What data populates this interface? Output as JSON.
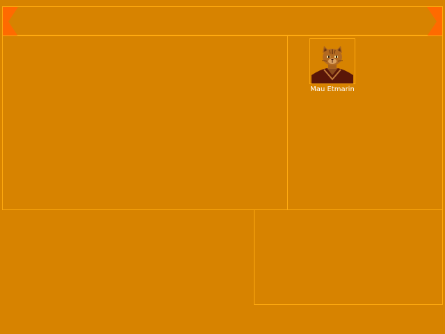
{
  "window": {
    "title": ""
  },
  "party": {
    "members": [
      {
        "name": "Mau Etmarin",
        "portrait_icon": "cat-warrior-portrait-icon"
      }
    ]
  },
  "colors": {
    "background": "#d78300",
    "border": "#ffaa10",
    "arrow": "#ff6a00",
    "text": "#ffffff"
  }
}
